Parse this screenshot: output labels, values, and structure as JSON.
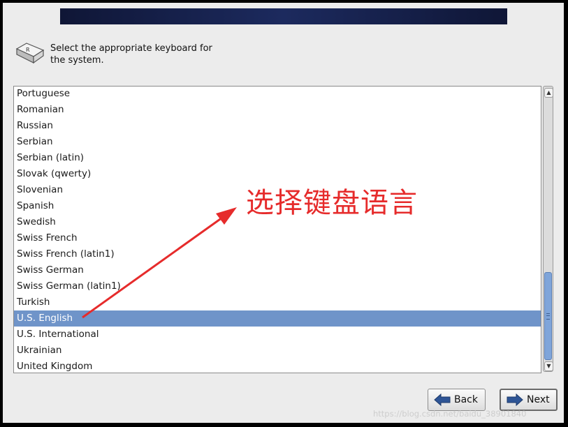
{
  "header": {
    "prompt": "Select the appropriate keyboard for the system."
  },
  "icons": {
    "keyboard": "keyboard-key-icon"
  },
  "keyboard_list": {
    "items": [
      "Portuguese",
      "Romanian",
      "Russian",
      "Serbian",
      "Serbian (latin)",
      "Slovak (qwerty)",
      "Slovenian",
      "Spanish",
      "Swedish",
      "Swiss French",
      "Swiss French (latin1)",
      "Swiss German",
      "Swiss German (latin1)",
      "Turkish",
      "U.S. English",
      "U.S. International",
      "Ukrainian",
      "United Kingdom"
    ],
    "selected": "U.S. English"
  },
  "buttons": {
    "back": "Back",
    "next": "Next"
  },
  "annotation": {
    "text": "选择键盘语言",
    "color": "#e62b2b"
  },
  "watermark": "https://blog.csdn.net/baidu_38901840",
  "colors": {
    "selection": "#6f94c9",
    "banner": "#1c2a5e"
  }
}
